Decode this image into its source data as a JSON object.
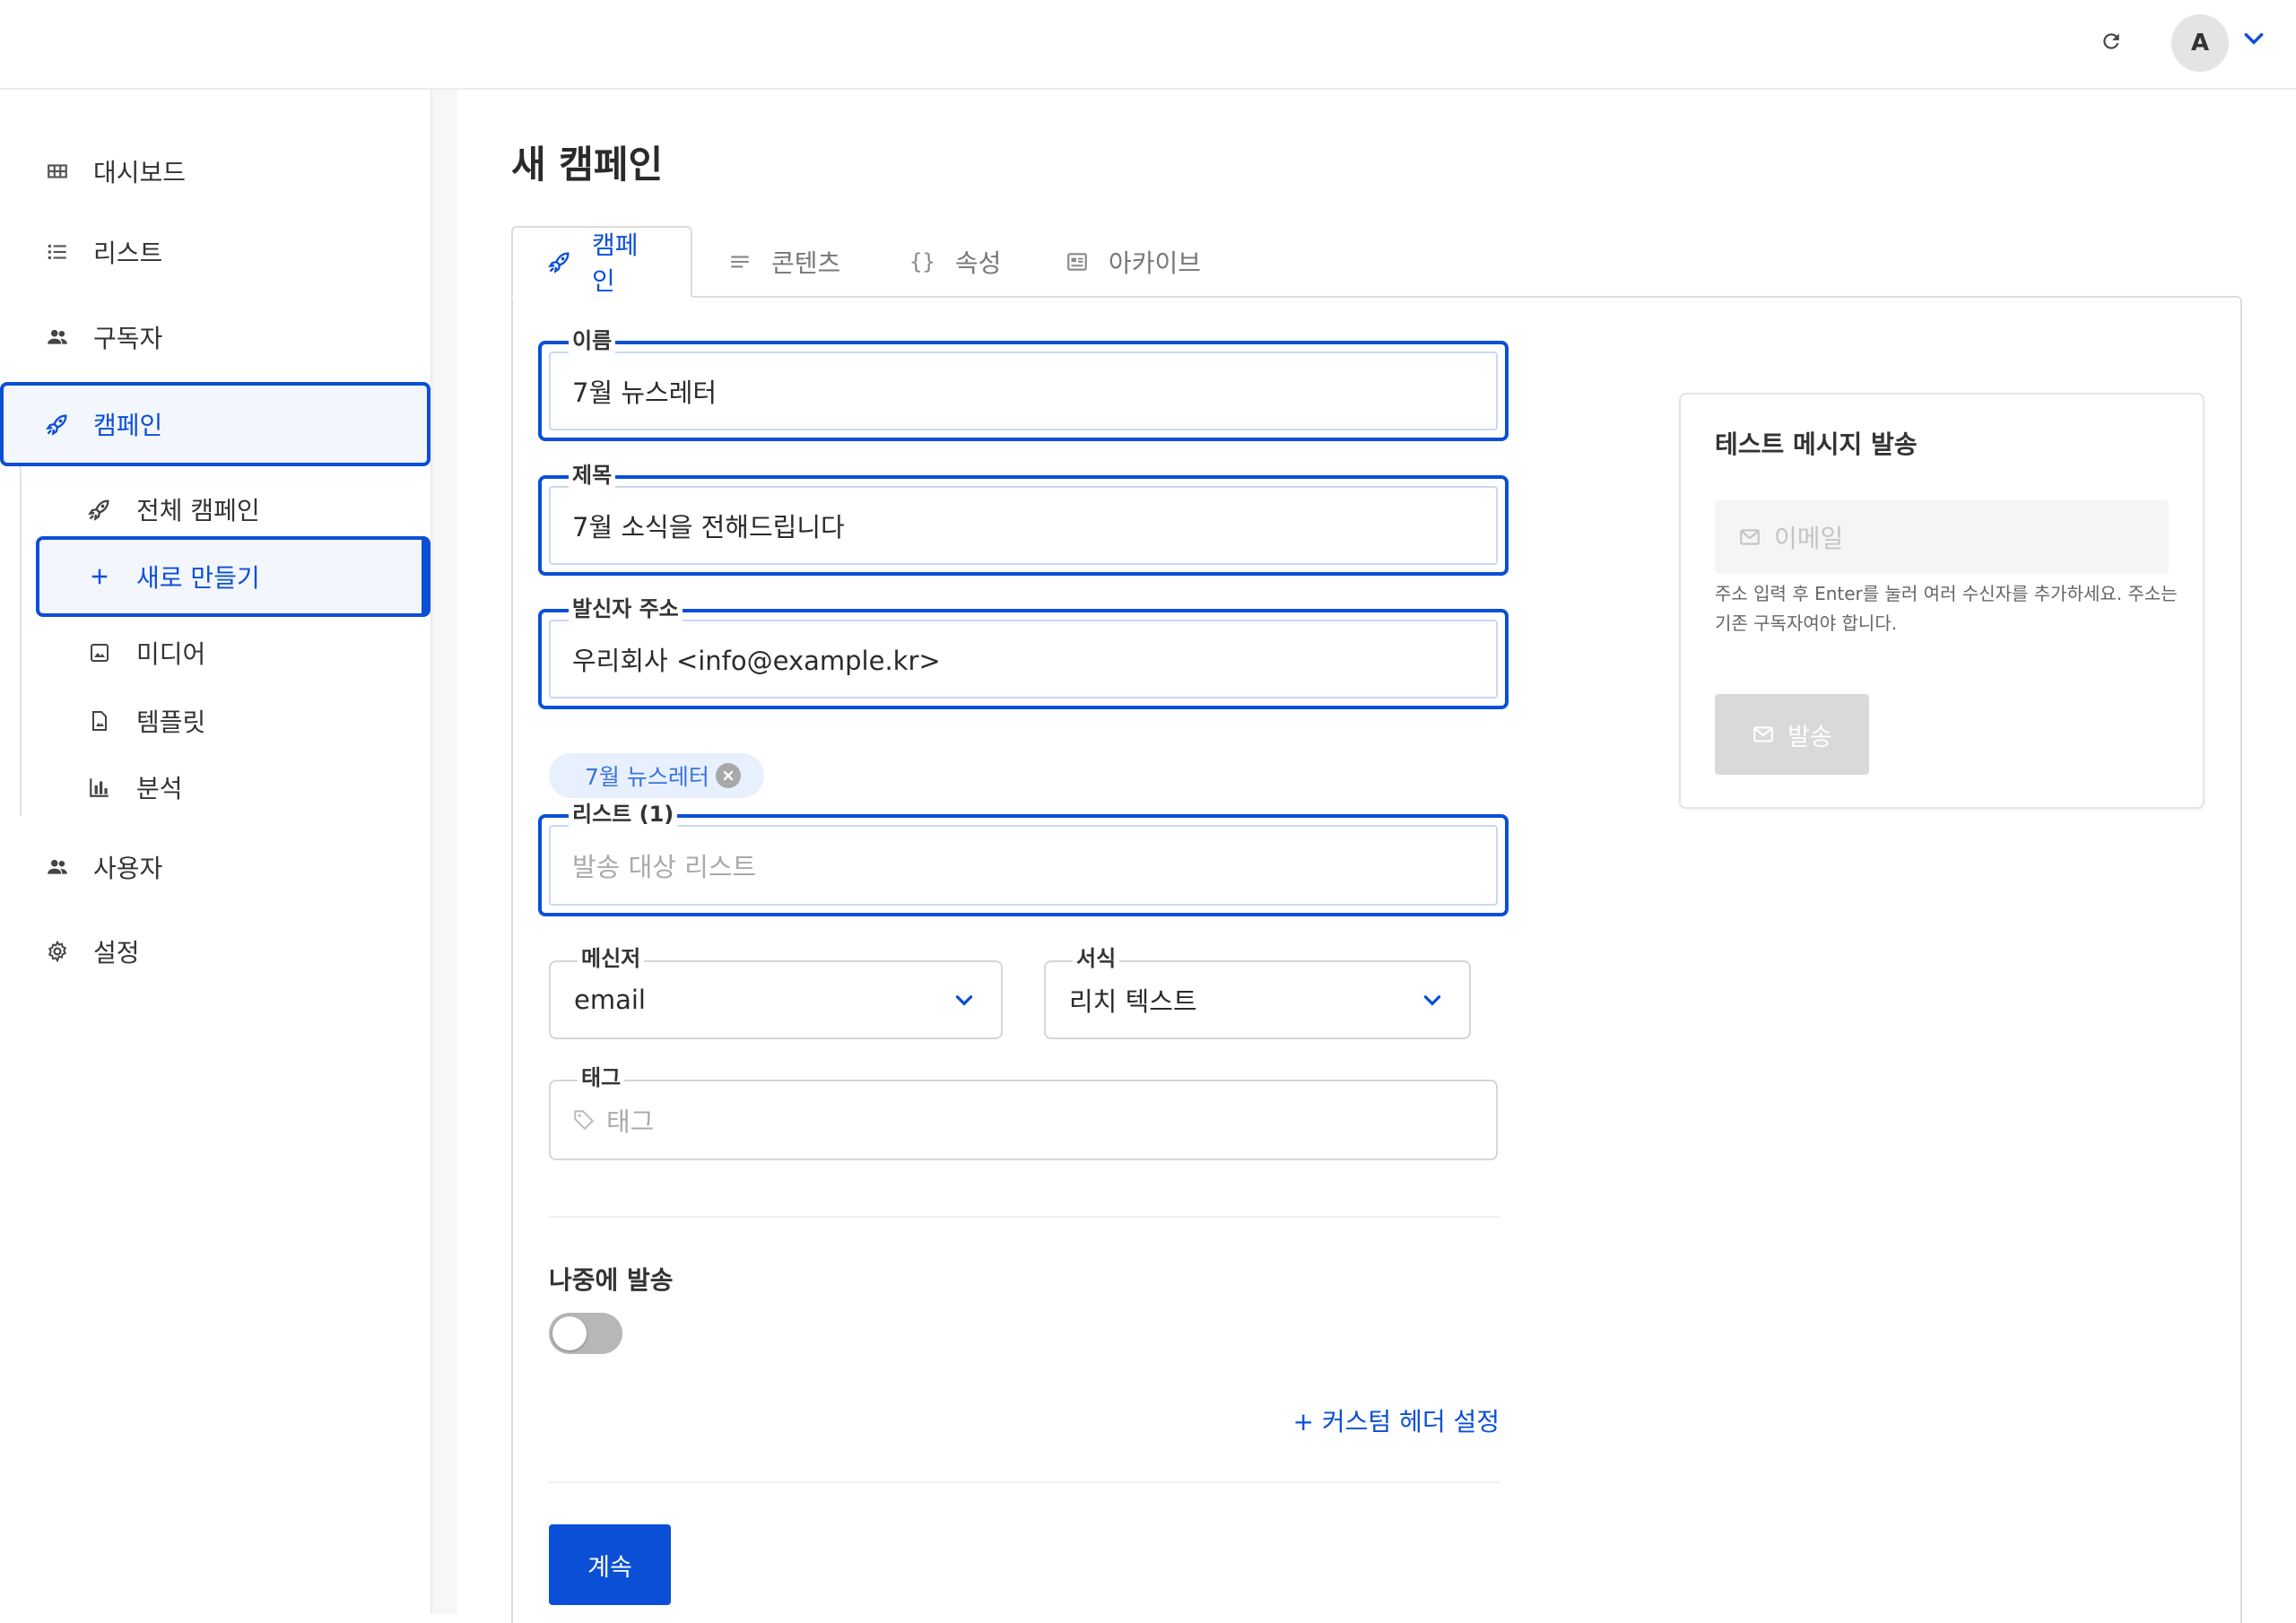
{
  "header": {
    "refresh_icon": "refresh-icon",
    "avatar_initial": "A",
    "caret_icon": "chevron-down-icon"
  },
  "sidebar": {
    "items": [
      {
        "label": "대시보드",
        "icon": "dashboard-icon"
      },
      {
        "label": "리스트",
        "icon": "list-icon"
      },
      {
        "label": "구독자",
        "icon": "users-icon"
      },
      {
        "label": "캠페인",
        "icon": "rocket-icon",
        "active": true
      },
      {
        "label": "사용자",
        "icon": "users-icon"
      },
      {
        "label": "설정",
        "icon": "gear-icon"
      }
    ],
    "sub_items": [
      {
        "label": "전체 캠페인",
        "icon": "rocket-icon"
      },
      {
        "label": "새로 만들기",
        "icon": "plus-icon",
        "active": true
      },
      {
        "label": "미디어",
        "icon": "image-icon"
      },
      {
        "label": "템플릿",
        "icon": "file-image-icon"
      },
      {
        "label": "분석",
        "icon": "bar-chart-icon"
      }
    ]
  },
  "page": {
    "title": "새 캠페인"
  },
  "tabs": [
    {
      "label": "캠페인",
      "icon": "rocket-icon",
      "active": true
    },
    {
      "label": "콘텐츠",
      "icon": "lines-icon"
    },
    {
      "label": "속성",
      "icon": "braces-icon"
    },
    {
      "label": "아카이브",
      "icon": "archive-icon"
    }
  ],
  "form": {
    "name": {
      "label": "이름",
      "value": "7월 뉴스레터"
    },
    "subject": {
      "label": "제목",
      "value": "7월 소식을 전해드립니다"
    },
    "from": {
      "label": "발신자 주소",
      "value": "우리회사 <info@example.kr>"
    },
    "list_chip": "7월 뉴스레터",
    "lists": {
      "label": "리스트 (1)",
      "placeholder": "발송 대상 리스트"
    },
    "messenger": {
      "label": "메신저",
      "value": "email"
    },
    "format": {
      "label": "서식",
      "value": "리치 텍스트"
    },
    "tags": {
      "label": "태그",
      "placeholder": "태그"
    },
    "send_later": {
      "label": "나중에 발송",
      "enabled": false
    },
    "custom_headers_link": "+ 커스텀 헤더 설정",
    "continue_button": "계속"
  },
  "test_message": {
    "title": "테스트 메시지 발송",
    "email_placeholder": "이메일",
    "help": "주소 입력 후 Enter를 눌러 여러 수신자를 추가하세요. 주소는 기존 구독자여야 합니다.",
    "send_button": "발송"
  },
  "colors": {
    "accent": "#0b4fd6",
    "chip_bg": "#e7f0fc",
    "disabled": "#d9d9d9"
  }
}
